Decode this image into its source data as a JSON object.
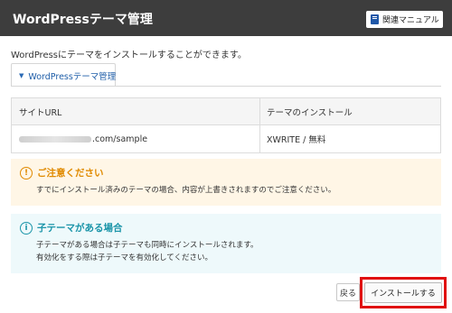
{
  "header": {
    "title": "WordPressテーマ管理",
    "manual_label": "関連マニュアル"
  },
  "description": "WordPressにテーマをインストールすることができます。",
  "tab": {
    "label": "WordPressテーマ管理"
  },
  "table": {
    "columns": [
      "サイトURL",
      "テーマのインストール"
    ],
    "rows": [
      {
        "url_suffix": ".com/sample",
        "theme": "XWRITE / 無料"
      }
    ]
  },
  "notice_warning": {
    "title": "ご注意ください",
    "body": "すでにインストール済みのテーマの場合、内容が上書きされますのでご注意ください。"
  },
  "notice_info": {
    "title": "子テーマがある場合",
    "lines": [
      "子テーマがある場合は子テーマも同時にインストールされます。",
      "有効化をする際は子テーマを有効化してください。"
    ]
  },
  "buttons": {
    "back": "戻る",
    "install": "インストールする"
  },
  "colors": {
    "accent_red": "#e01010",
    "link_blue": "#1f5ea8",
    "warn_orange": "#e08a00",
    "info_teal": "#1b95a9"
  },
  "icons": {
    "manual": "book-icon",
    "tab": "chevron-down-icon",
    "warning": "exclamation-icon",
    "info": "info-icon"
  }
}
